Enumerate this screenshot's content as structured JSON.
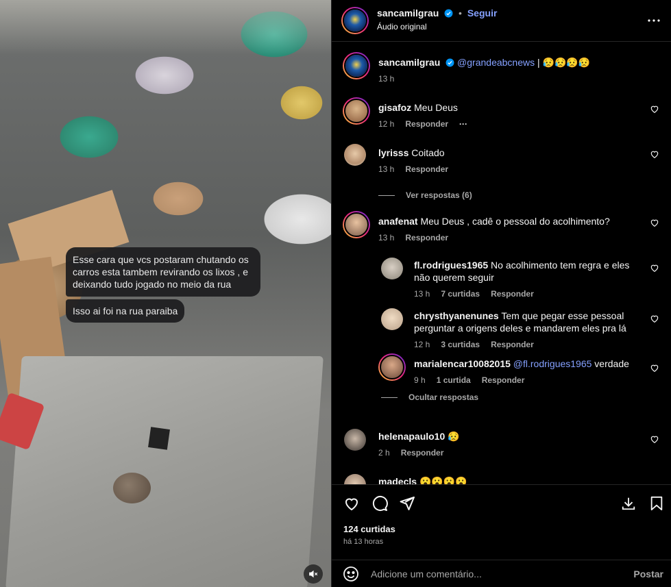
{
  "post": {
    "author": "sancamilgrau",
    "follow_label": "Seguir",
    "audio": "Áudio original",
    "dot": "•"
  },
  "chat_overlay": {
    "message1": "Esse cara que vcs postaram chutando os carros esta tambem revirando os lixos , e deixando tudo jogado no meio da rua",
    "message2": "Isso ai foi na rua paraiba"
  },
  "caption": {
    "user": "sancamilgrau",
    "mention": "@grandeabcnews",
    "rest": " | 😥😥😥😥",
    "time": "13 h"
  },
  "comments": [
    {
      "user": "gisafoz",
      "text": "Meu Deus",
      "time": "12 h",
      "reply": "Responder",
      "more": "···"
    },
    {
      "user": "lyrisss",
      "text": "Coitado",
      "time": "13 h",
      "reply": "Responder",
      "view_replies": "Ver respostas (6)"
    },
    {
      "user": "anafenat",
      "text": "Meu Deus , cadê o pessoal do acolhimento?",
      "time": "13 h",
      "reply": "Responder"
    },
    {
      "user": "helenapaulo10",
      "text": "😥",
      "time": "2 h",
      "reply": "Responder"
    },
    {
      "user": "madecls",
      "text": "😮😮😮😮"
    }
  ],
  "replies": [
    {
      "user": "fl.rodrigues1965",
      "text": "No acolhimento tem regra e eles não querem seguir",
      "time": "13 h",
      "likes": "7 curtidas",
      "reply": "Responder"
    },
    {
      "user": "chrysthyanenunes",
      "text": "Tem que pegar esse pessoal perguntar a origens deles e mandarem eles pra lá",
      "time": "12 h",
      "likes": "3 curtidas",
      "reply": "Responder"
    },
    {
      "user": "marialencar10082015",
      "mention": "@fl.rodrigues1965",
      "text": " verdade",
      "time": "9 h",
      "likes": "1 curtida",
      "reply": "Responder"
    }
  ],
  "hide_replies": "Ocultar respostas",
  "likes_count": "124 curtidas",
  "posted_ago": "há 13 horas",
  "comment_input": {
    "placeholder": "Adicione um comentário...",
    "post_label": "Postar"
  },
  "icons": {
    "like": "heart-icon",
    "comment": "comment-icon",
    "share": "share-icon",
    "download": "download-icon",
    "save": "bookmark-icon",
    "more": "more-icon",
    "emoji": "emoji-icon",
    "mute": "muted-icon"
  },
  "colors": {
    "link": "#85a1ff",
    "verified": "#0095f6",
    "muted_text": "#a8a8a8",
    "background": "#000000"
  }
}
